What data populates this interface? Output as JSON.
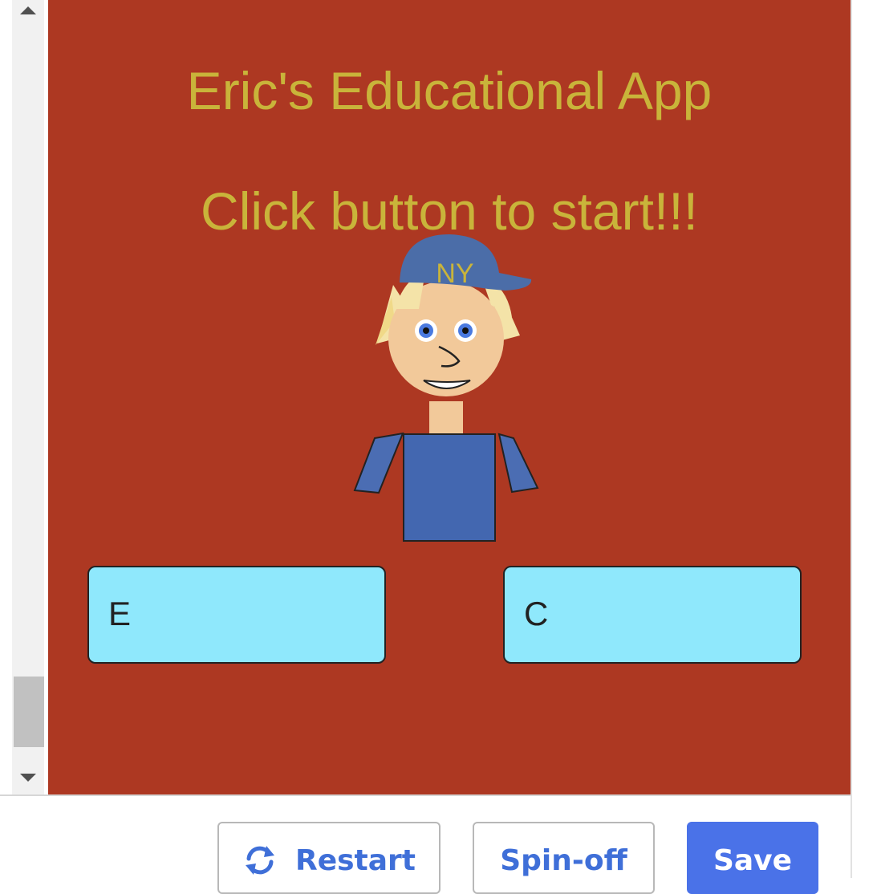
{
  "canvas": {
    "title": "Eric's Educational App",
    "subtitle": "Click button to start!!!",
    "cap_text": "NY",
    "background_color": "#ad3822",
    "text_color": "#c9b43a"
  },
  "answers": {
    "left_label": "E",
    "right_label": "C",
    "button_color": "#8fe8fc"
  },
  "toolbar": {
    "restart_label": "Restart",
    "restart_icon": "restart-icon",
    "spinoff_label": "Spin-off",
    "save_label": "Save",
    "accent_color": "#4a72e8"
  },
  "scrollbar": {
    "up_icon": "triangle-up-icon",
    "down_icon": "triangle-down-icon"
  }
}
